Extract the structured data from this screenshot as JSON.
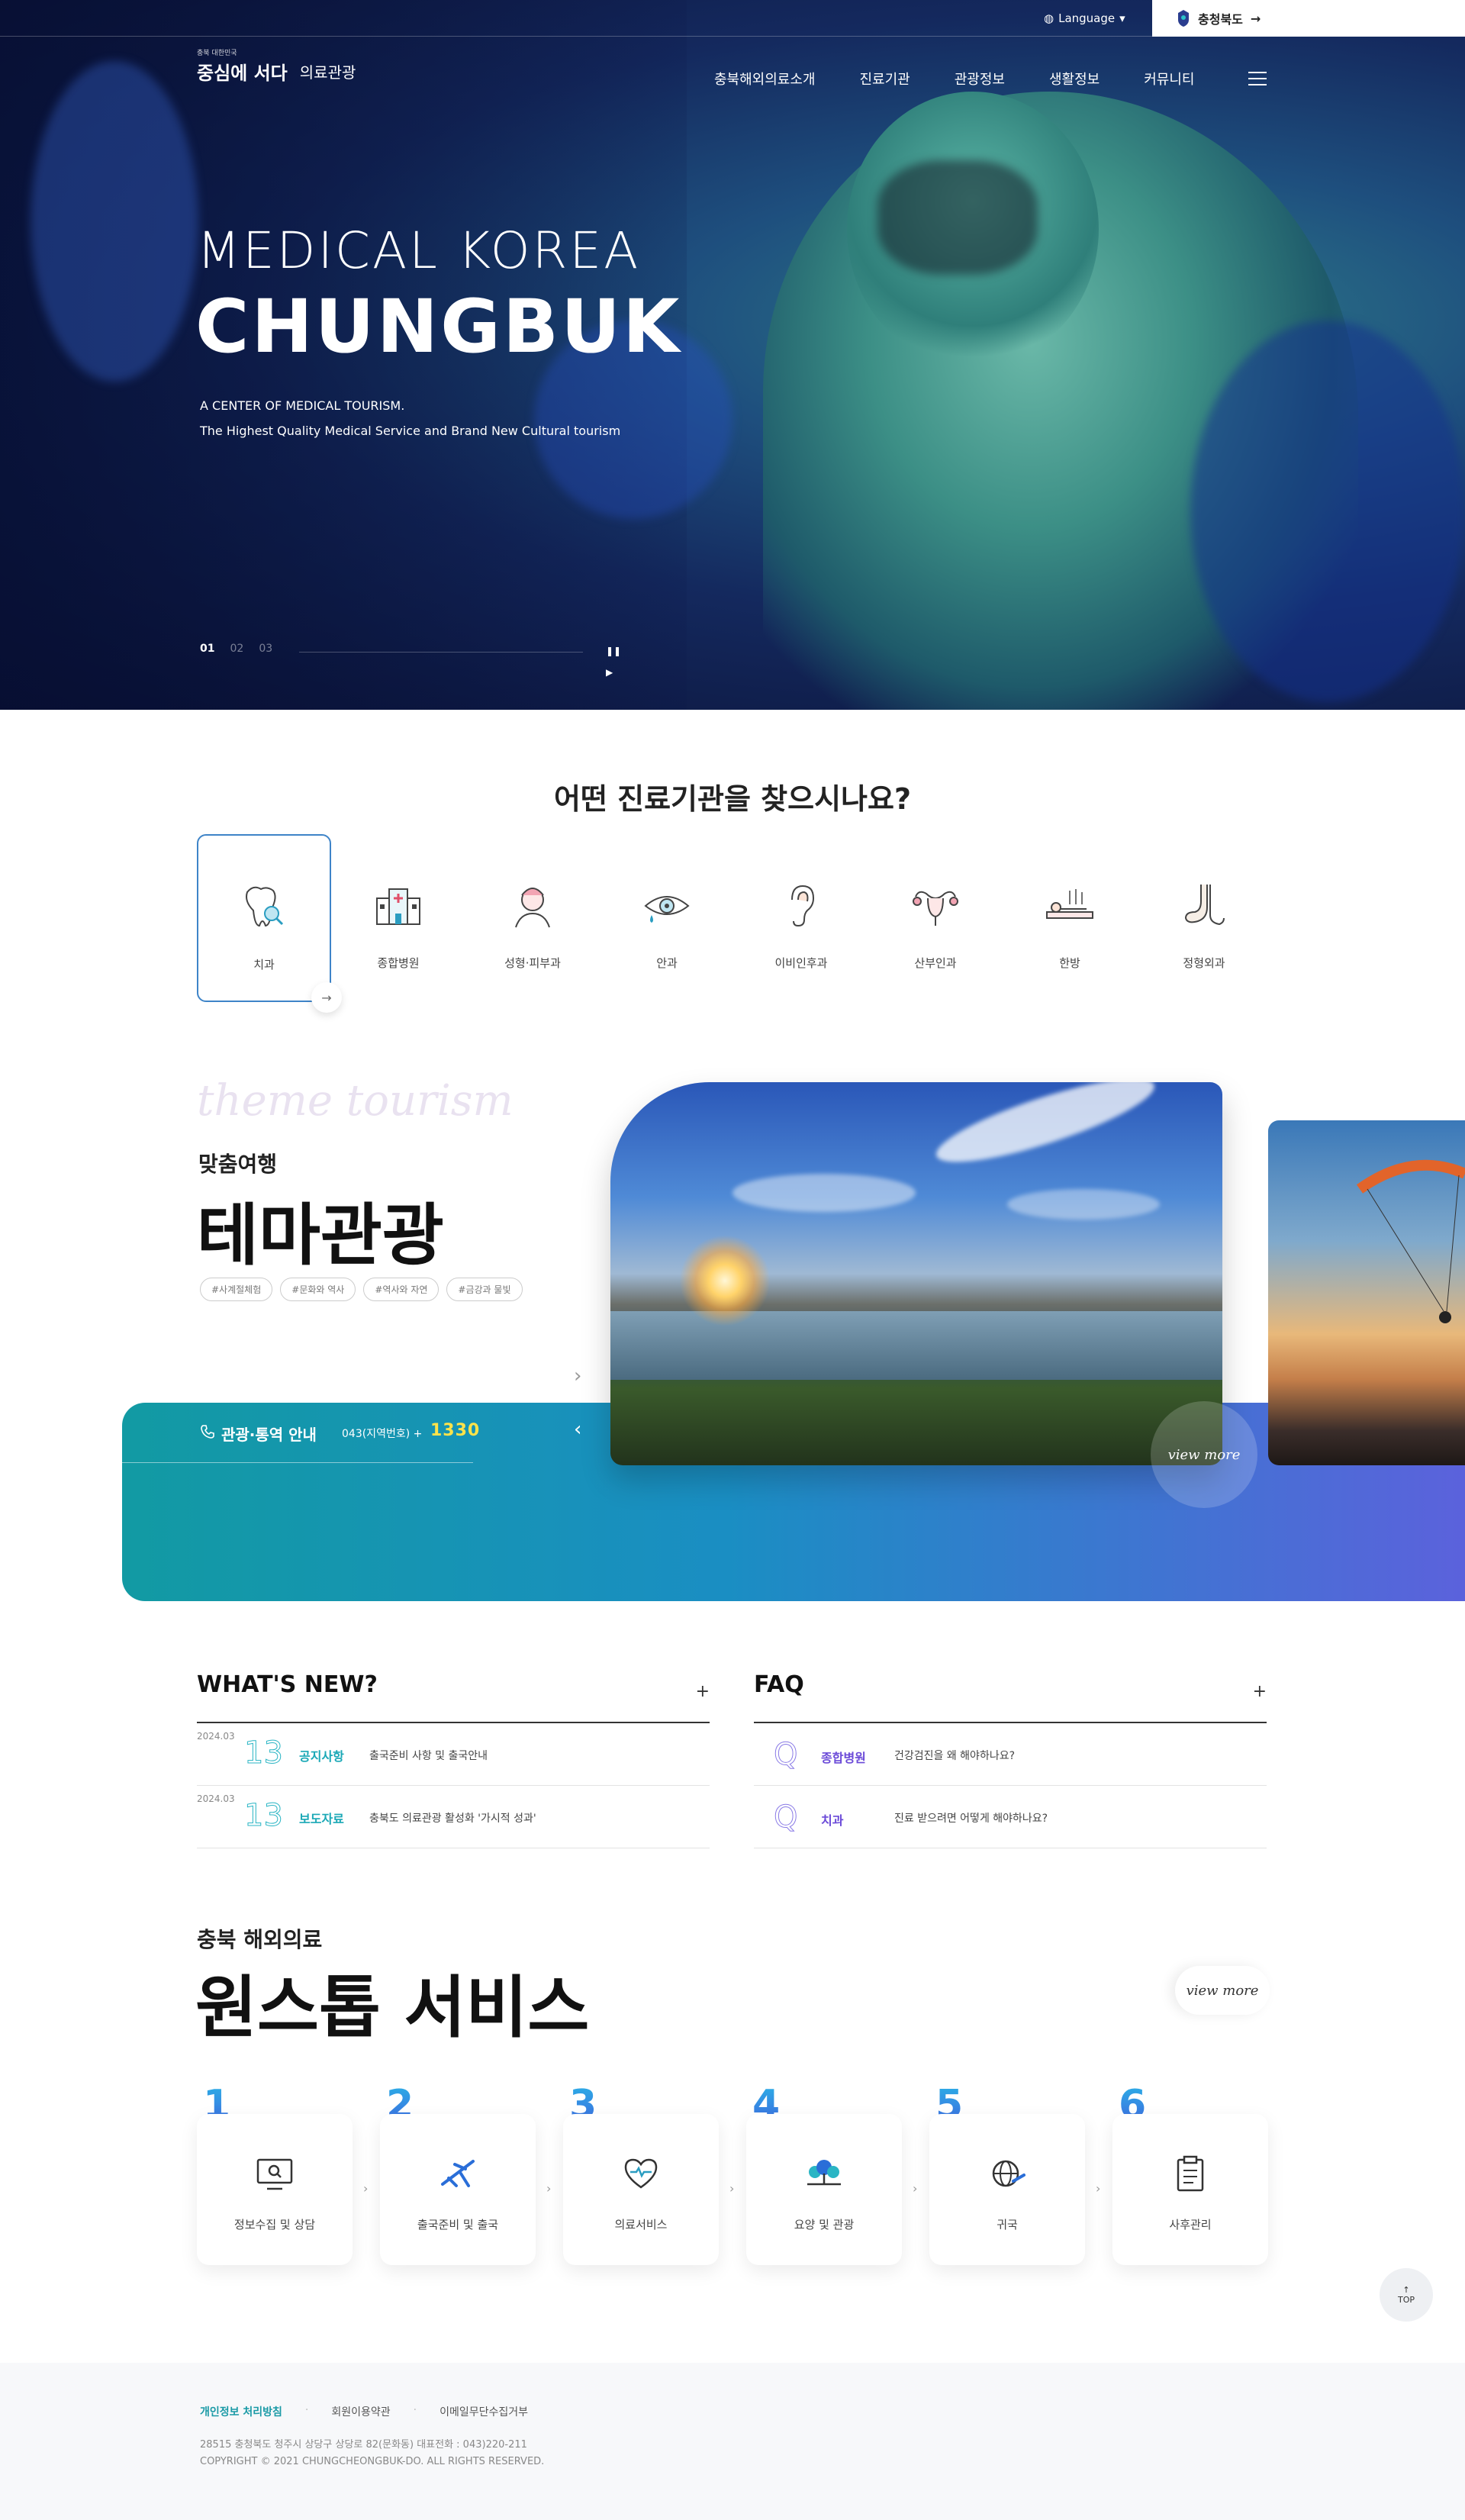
{
  "header": {
    "language_label": "Language",
    "region_label": "충청북도",
    "logo_small": "충북 대한민국",
    "logo_main": "중심에 서다",
    "logo_sub": "의료관광",
    "nav": [
      "충북해외의료소개",
      "진료기관",
      "관광정보",
      "생활정보",
      "커뮤니티"
    ]
  },
  "hero": {
    "title_line1": "MEDICAL KOREA",
    "title_line2": "CHUNGBUK",
    "sub_line1": "A CENTER OF MEDICAL TOURISM.",
    "sub_line2": "The Highest Quality Medical Service and Brand New Cultural tourism",
    "slides": [
      "01",
      "02",
      "03"
    ],
    "active_slide": "01"
  },
  "clinic_search": {
    "title": "어떤 진료기관을 찾으시나요?",
    "categories": [
      {
        "label": "치과",
        "icon": "tooth-icon",
        "active": true
      },
      {
        "label": "종합병원",
        "icon": "hospital-icon"
      },
      {
        "label": "성형·피부과",
        "icon": "face-icon"
      },
      {
        "label": "안과",
        "icon": "eye-icon"
      },
      {
        "label": "이비인후과",
        "icon": "ear-icon"
      },
      {
        "label": "산부인과",
        "icon": "uterus-icon"
      },
      {
        "label": "한방",
        "icon": "herbal-bed-icon"
      },
      {
        "label": "정형외과",
        "icon": "foot-bone-icon"
      }
    ]
  },
  "theme_tourism": {
    "script": "theme tourism",
    "subtitle": "맞춤여행",
    "title": "테마관광",
    "tags": [
      "#사계절체험",
      "#문화와 역사",
      "#역사와 자연",
      "#금강과 물빛"
    ],
    "view_more": "view more",
    "guide_title": "관광·통역 안내",
    "guide_phone": "043(지역번호) +",
    "guide_number": "1330"
  },
  "whats_new": {
    "title": "WHAT'S NEW?",
    "items": [
      {
        "date": "2024.03",
        "day": "13",
        "category": "공지사항",
        "text": "출국준비 사항 및 출국안내"
      },
      {
        "date": "2024.03",
        "day": "13",
        "category": "보도자료",
        "text": "충북도 의료관광 활성화 '가시적 성과'"
      }
    ]
  },
  "faq": {
    "title": "FAQ",
    "items": [
      {
        "q": "Q",
        "category": "종합병원",
        "text": "건강검진을 왜 해야하나요?"
      },
      {
        "q": "Q",
        "category": "치과",
        "text": "진료 받으려면 어떻게 해야하나요?"
      }
    ]
  },
  "one_stop": {
    "subtitle": "충북 해외의료",
    "title": "원스톱 서비스",
    "view_more": "view more",
    "steps": [
      {
        "num": "1",
        "label": "정보수집 및 상담",
        "icon": "monitor-search-icon"
      },
      {
        "num": "2",
        "label": "출국준비 및 출국",
        "icon": "airplane-icon"
      },
      {
        "num": "3",
        "label": "의료서비스",
        "icon": "heart-pulse-icon"
      },
      {
        "num": "4",
        "label": "요양 및 관광",
        "icon": "trees-icon"
      },
      {
        "num": "5",
        "label": "귀국",
        "icon": "globe-plane-icon"
      },
      {
        "num": "6",
        "label": "사후관리",
        "icon": "clipboard-icon"
      }
    ]
  },
  "top_button": "TOP",
  "footer": {
    "links": [
      "개인정보 처리방침",
      "회원이용약관",
      "이메일무단수집거부"
    ],
    "address": "28515 충청북도 청주시 상당구 상당로 82(문화동)      대표전화 : 043)220-211",
    "copyright": "COPYRIGHT © 2021 CHUNGCHEONGBUK-DO. ALL RIGHTS RESERVED."
  },
  "colors": {
    "teal": "#1aa8b6",
    "purple": "#5b62dc",
    "active_border": "#3e84c8"
  }
}
